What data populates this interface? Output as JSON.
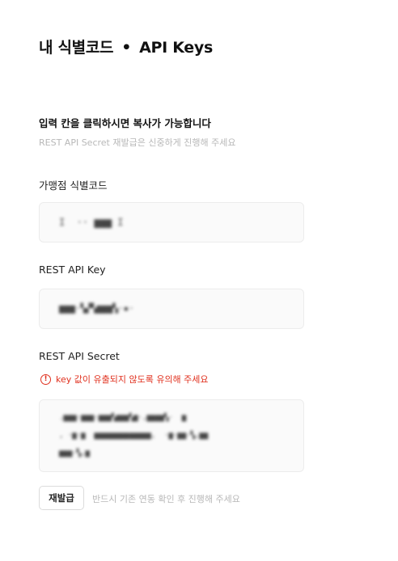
{
  "header": {
    "title_main": "내 식별코드",
    "separator": "•",
    "title_sub": "API Keys"
  },
  "notice": {
    "title": "입력 칸을 클릭하시면 복사가 가능합니다",
    "subtitle": "REST API Secret 재발급은 신중하게 진행해 주세요"
  },
  "fields": {
    "merchant_code": {
      "label": "가맹점 식별코드",
      "masked_value": "I  ·· ▆▆▆ I"
    },
    "rest_api_key": {
      "label": "REST API Key",
      "masked_value": "▆▆▆·▚▞▚▆▆▆▚·▪·"
    },
    "rest_api_secret": {
      "label": "REST API Secret",
      "masked_value": ".▆▆▆·▆▆▆·▆▆▆▚▆▆▆▚▆·,▆▆▆▆▚·  ▆\n, ·▆·▆  ▆▆▆▆▆▆▆▆▆▆▆▆▆,  ·▆·▆▆·▚,▆▆\n▆▆▆·▚,▆",
      "warning": "key 값이 유출되지 않도록 유의해 주세요",
      "warning_icon": "exclamation-circle-icon"
    }
  },
  "reissue": {
    "button_label": "재발급",
    "note": "반드시 기존 연동 확인 후 진행해 주세요"
  },
  "colors": {
    "warning": "#e0301e",
    "muted": "#b8b8b8",
    "field_bg": "#fafafa"
  }
}
